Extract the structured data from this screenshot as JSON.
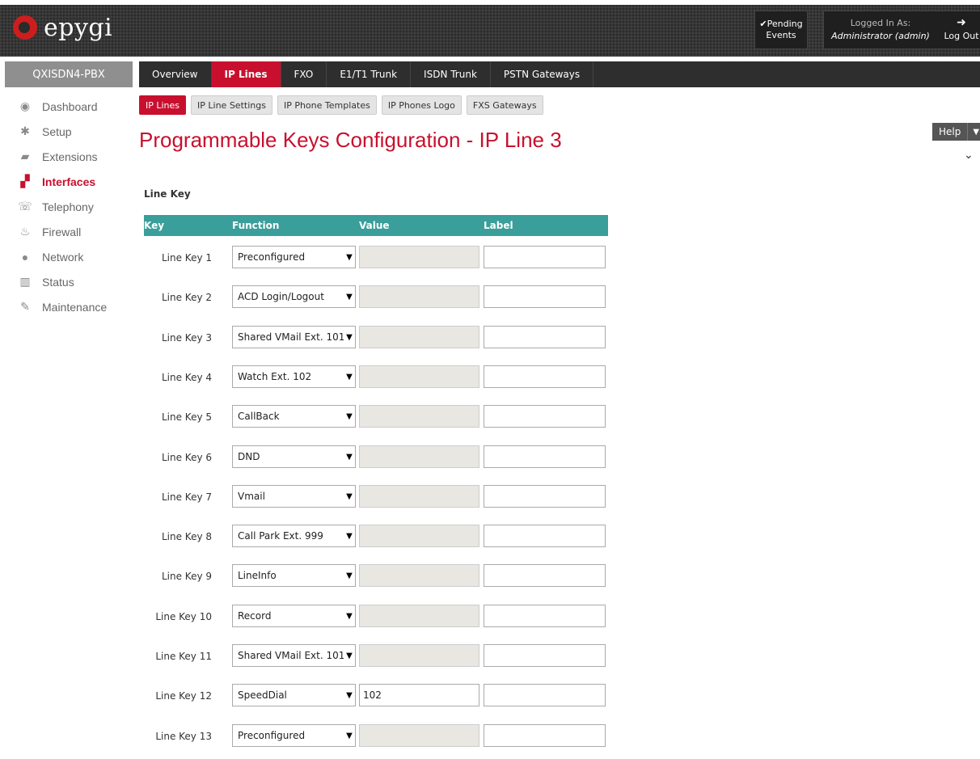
{
  "header": {
    "logo_text": "epygi",
    "pending_check": "✔",
    "pending_line1": "Pending",
    "pending_line2": "Events",
    "logged_in_label": "Logged In As:",
    "logged_in_user": "Administrator (admin)",
    "logout_label": "Log Out"
  },
  "sidebar": {
    "device": "QXISDN4-PBX",
    "items": [
      {
        "label": "Dashboard",
        "icon": "dashboard-icon"
      },
      {
        "label": "Setup",
        "icon": "gear-icon"
      },
      {
        "label": "Extensions",
        "icon": "book-icon"
      },
      {
        "label": "Interfaces",
        "icon": "network-tree-icon"
      },
      {
        "label": "Telephony",
        "icon": "phone-icon"
      },
      {
        "label": "Firewall",
        "icon": "fire-icon"
      },
      {
        "label": "Network",
        "icon": "globe-icon"
      },
      {
        "label": "Status",
        "icon": "bar-chart-icon"
      },
      {
        "label": "Maintenance",
        "icon": "wrench-icon"
      }
    ]
  },
  "tabs": [
    "Overview",
    "IP Lines",
    "FXO",
    "E1/T1 Trunk",
    "ISDN Trunk",
    "PSTN Gateways"
  ],
  "subtabs": [
    "IP Lines",
    "IP Line Settings",
    "IP Phone Templates",
    "IP Phones Logo",
    "FXS Gateways"
  ],
  "page": {
    "title": "Programmable Keys Configuration - IP Line 3",
    "help_label": "Help",
    "section_title": "Line Key"
  },
  "table": {
    "headers": [
      "Key",
      "Function",
      "Value",
      "Label"
    ],
    "rows": [
      {
        "key": "Line Key 1",
        "function": "Preconfigured",
        "value": "",
        "label": ""
      },
      {
        "key": "Line Key 2",
        "function": "ACD Login/Logout",
        "value": "",
        "label": ""
      },
      {
        "key": "Line Key 3",
        "function": "Shared VMail Ext. 101",
        "value": "",
        "label": ""
      },
      {
        "key": "Line Key 4",
        "function": "Watch Ext. 102",
        "value": "",
        "label": ""
      },
      {
        "key": "Line Key 5",
        "function": "CallBack",
        "value": "",
        "label": ""
      },
      {
        "key": "Line Key 6",
        "function": "DND",
        "value": "",
        "label": ""
      },
      {
        "key": "Line Key 7",
        "function": "Vmail",
        "value": "",
        "label": ""
      },
      {
        "key": "Line Key 8",
        "function": "Call Park Ext. 999",
        "value": "",
        "label": ""
      },
      {
        "key": "Line Key 9",
        "function": "LineInfo",
        "value": "",
        "label": ""
      },
      {
        "key": "Line Key 10",
        "function": "Record",
        "value": "",
        "label": ""
      },
      {
        "key": "Line Key 11",
        "function": "Shared VMail Ext. 101",
        "value": "",
        "label": ""
      },
      {
        "key": "Line Key 12",
        "function": "SpeedDial",
        "value": "102",
        "label": ""
      },
      {
        "key": "Line Key 13",
        "function": "Preconfigured",
        "value": "",
        "label": ""
      }
    ]
  },
  "colors": {
    "accent": "#c8102e",
    "table_header": "#3a9e9b",
    "topbar": "#2b2b2b"
  }
}
